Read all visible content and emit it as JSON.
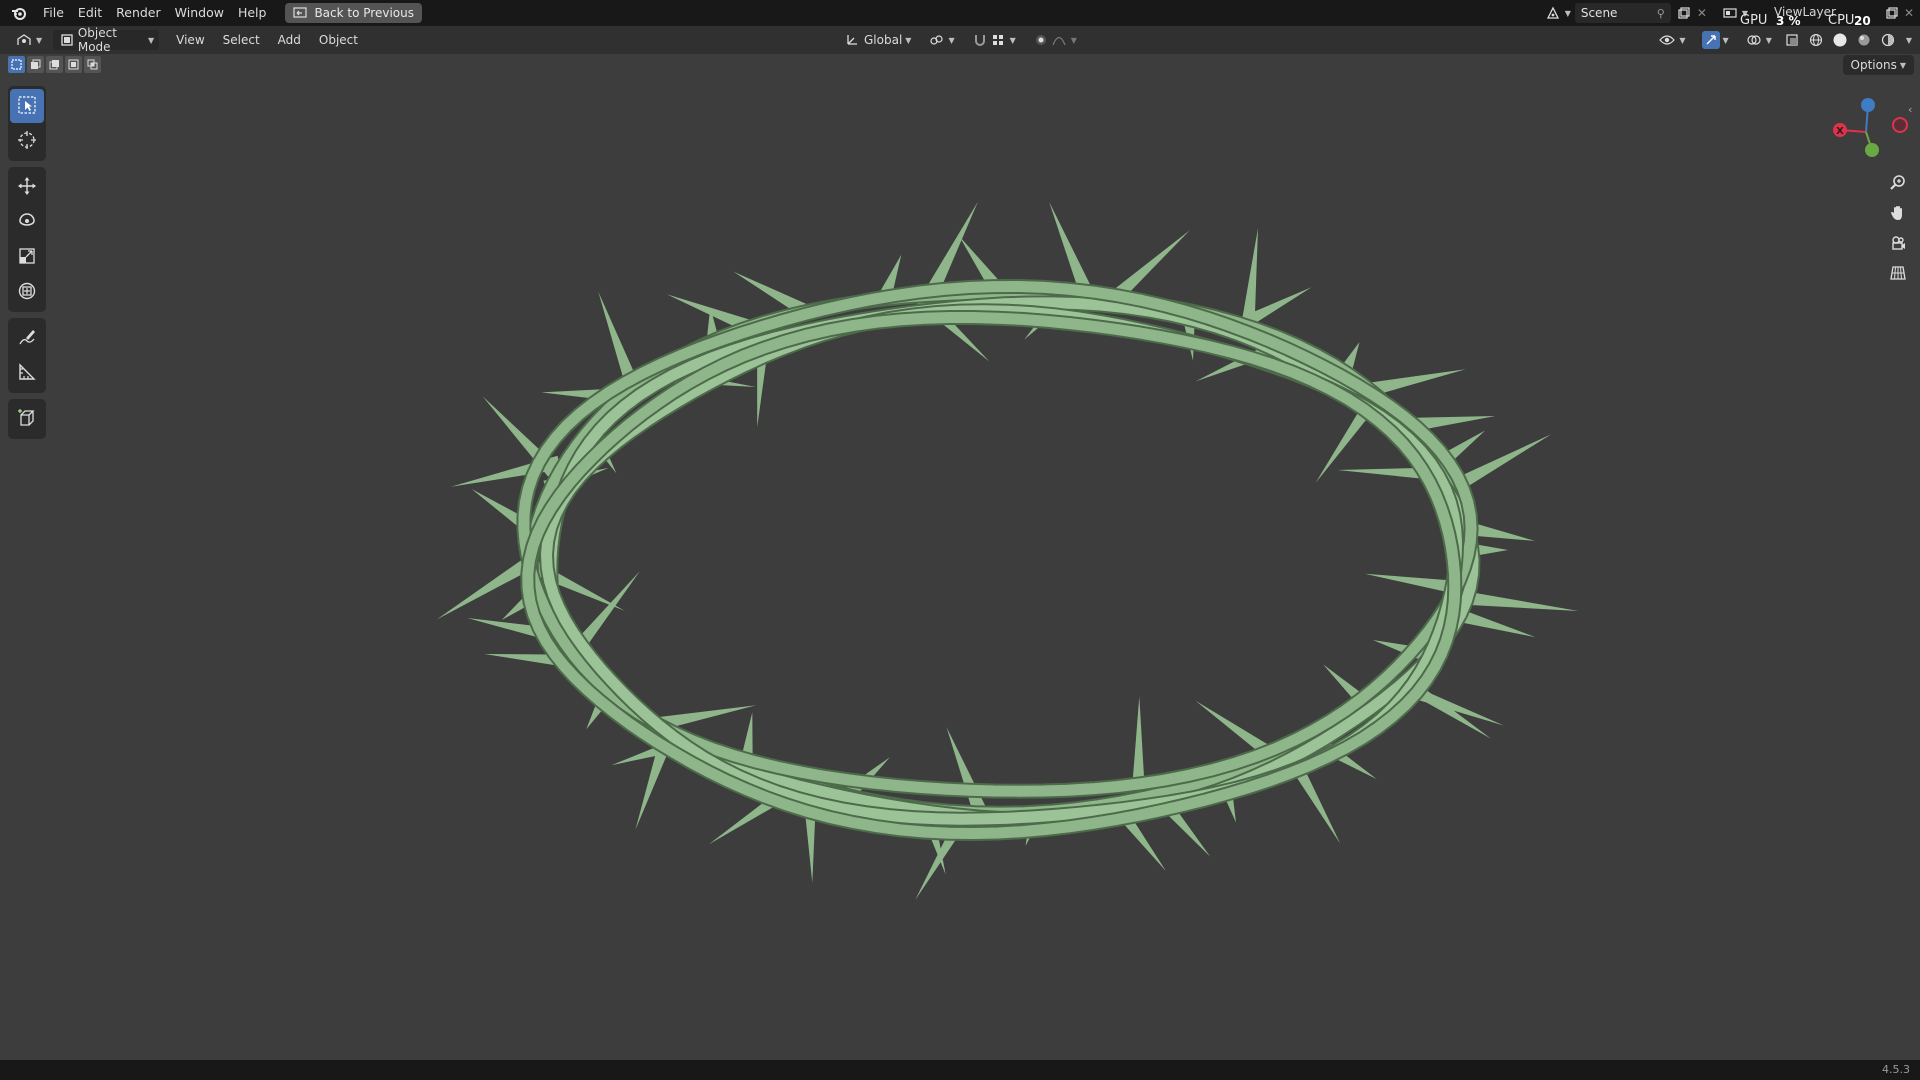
{
  "menubar": {
    "items": [
      "File",
      "Edit",
      "Render",
      "Window",
      "Help"
    ],
    "back_button": "Back to Previous"
  },
  "topbar_right": {
    "scene_name": "Scene",
    "view_layer": "ViewLayer",
    "gpu_label": "GPU",
    "gpu_value": "3 %",
    "cpu_label": "CPU",
    "cpu_value": "20 %"
  },
  "header": {
    "mode": "Object Mode",
    "menus": [
      "View",
      "Select",
      "Add",
      "Object"
    ],
    "transform_orientation": "Global"
  },
  "options_label": "Options",
  "version": "4.5.3",
  "colors": {
    "model": "#8fb68a",
    "viewport_bg": "#3d3d3d",
    "accent": "#4772b3",
    "axis_x": "#e0314d",
    "axis_y": "#6aa843",
    "axis_z": "#3e7cc4"
  }
}
